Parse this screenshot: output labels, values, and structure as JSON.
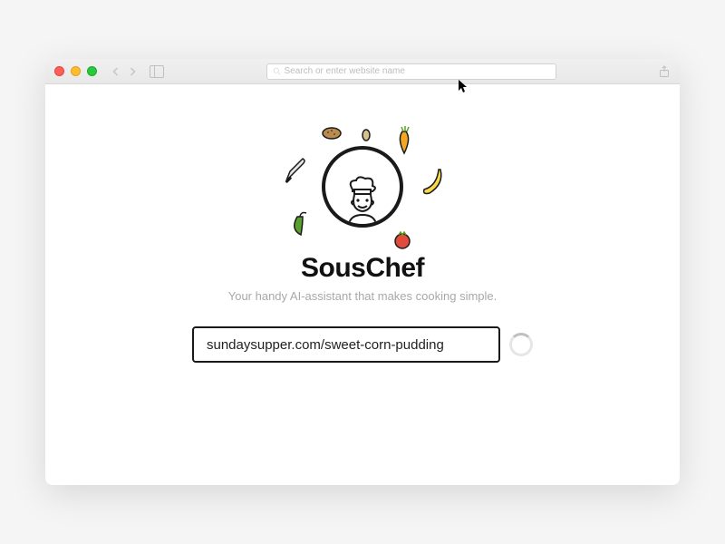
{
  "browser": {
    "address_placeholder": "Search or enter website name"
  },
  "app": {
    "title": "SousChef",
    "tagline": "Your handy AI-assistant that makes cooking simple."
  },
  "input": {
    "value": "sundaysupper.com/sweet-corn-pudding"
  },
  "orbit_icons": {
    "knife": "knife-icon",
    "potato": "potato-icon",
    "carrot": "carrot-icon",
    "banana": "banana-icon",
    "chili": "chili-icon",
    "tomato": "tomato-icon"
  },
  "colors": {
    "text_primary": "#111111",
    "text_muted": "#a8a8a8",
    "border_strong": "#1a1a1a",
    "traffic_red": "#ff5f56",
    "traffic_yellow": "#ffbd2e",
    "traffic_green": "#27c93f"
  }
}
